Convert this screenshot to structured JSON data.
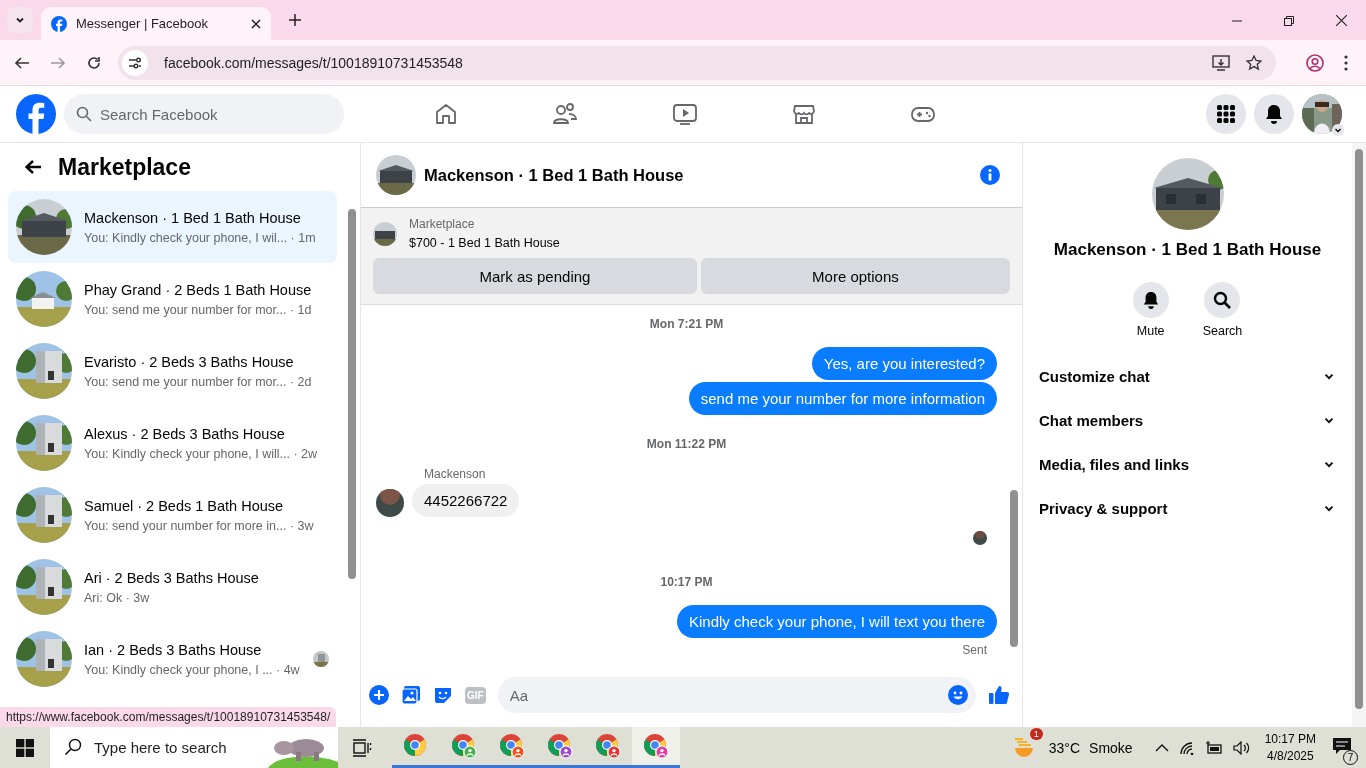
{
  "browser": {
    "tabs": [
      {
        "title": "Messenger | Facebook",
        "selected": true
      }
    ],
    "url": "facebook.com/messages/t/10018910731453548"
  },
  "header": {
    "search_placeholder": "Search Facebook"
  },
  "sidebar": {
    "title": "Marketplace",
    "conversations": [
      {
        "name": "Mackenson · 1 Bed 1 Bath House",
        "preview": "You: Kindly check your phone, I wil... · 1m",
        "selected": true,
        "seen": false
      },
      {
        "name": "Phay Grand · 2 Beds 1 Bath House",
        "preview": "You: send me your number for mor... · 1d",
        "selected": false,
        "seen": false
      },
      {
        "name": "Evaristo · 2 Beds 3 Baths House",
        "preview": "You: send me your number for mor... · 2d",
        "selected": false,
        "seen": false
      },
      {
        "name": "Alexus · 2 Beds 3 Baths House",
        "preview": "You: Kindly check your phone, I will... · 2w",
        "selected": false,
        "seen": false
      },
      {
        "name": "Samuel · 2 Beds 1 Bath House",
        "preview": "You: send your number for more in... · 3w",
        "selected": false,
        "seen": false
      },
      {
        "name": "Ari · 2 Beds 3 Baths House",
        "preview": "Ari: Ok · 3w",
        "selected": false,
        "seen": false
      },
      {
        "name": "Ian · 2 Beds 3 Baths House",
        "preview": "You: Kindly check your phone, I ... · 4w",
        "selected": false,
        "seen": true
      }
    ]
  },
  "status_url": "https://www.facebook.com/messages/t/10018910731453548/",
  "chat": {
    "title": "Mackenson · 1 Bed 1 Bath House",
    "listing": {
      "label": "Marketplace",
      "title": "$700 - 1 Bed 1 Bath House"
    },
    "buttons": [
      "Mark as pending",
      "More options"
    ],
    "messages": [
      {
        "kind": "timestamp",
        "text": "Mon 7:21 PM"
      },
      {
        "kind": "outgoing",
        "text": "Yes, are you interested?"
      },
      {
        "kind": "outgoing",
        "text": "send me your number for more information"
      },
      {
        "kind": "timestamp",
        "text": "Mon 11:22 PM"
      },
      {
        "kind": "incoming",
        "sender": "Mackenson",
        "text": "4452266722"
      },
      {
        "kind": "seen"
      },
      {
        "kind": "timestamp",
        "text": "10:17 PM"
      },
      {
        "kind": "outgoing",
        "text": "Kindly check your phone, I will text you there"
      },
      {
        "kind": "status",
        "text": "Sent"
      }
    ],
    "composer": {
      "placeholder": "Aa",
      "gif": "GIF"
    }
  },
  "details": {
    "name": "Mackenson · 1 Bed 1 Bath House",
    "actions": [
      {
        "kind": "mute",
        "label": "Mute"
      },
      {
        "kind": "search",
        "label": "Search"
      }
    ],
    "sections": [
      {
        "label": "Customize chat",
        "expanded": false
      },
      {
        "label": "Chat members",
        "expanded": false
      },
      {
        "label": "Media, files and links",
        "expanded": false
      },
      {
        "label": "Privacy & support",
        "expanded": false
      }
    ]
  },
  "taskbar": {
    "search_placeholder": "Type here to search",
    "apps": [
      {
        "kind": "chrome",
        "selected": false
      },
      {
        "kind": "profile",
        "color": "#4caf50",
        "selected": false
      },
      {
        "kind": "profile",
        "color": "#f4511e",
        "selected": false
      },
      {
        "kind": "profile",
        "color": "#9c4dcc",
        "selected": false
      },
      {
        "kind": "profile",
        "color": "#e53935",
        "selected": false
      },
      {
        "kind": "profile",
        "color": "#e040a0",
        "selected": true
      }
    ],
    "weather_badge": "1",
    "temperature": "33°C",
    "condition": "Smoke",
    "time": "10:17 PM",
    "date": "4/8/2025",
    "notifications": "7"
  }
}
